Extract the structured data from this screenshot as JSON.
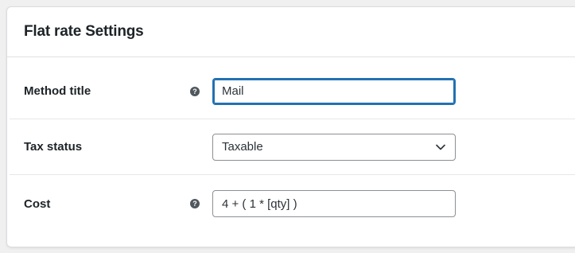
{
  "dialog": {
    "title": "Flat rate Settings"
  },
  "fields": {
    "method_title": {
      "label": "Method title",
      "value": "Mail",
      "help_icon": "question-circle-icon"
    },
    "tax_status": {
      "label": "Tax status",
      "value": "Taxable",
      "icon": "chevron-down-icon"
    },
    "cost": {
      "label": "Cost",
      "value": "4 + ( 1 * [qty] )",
      "help_icon": "question-circle-icon"
    }
  },
  "colors": {
    "focus_border": "#2271b1",
    "help_icon": "#50575e"
  }
}
